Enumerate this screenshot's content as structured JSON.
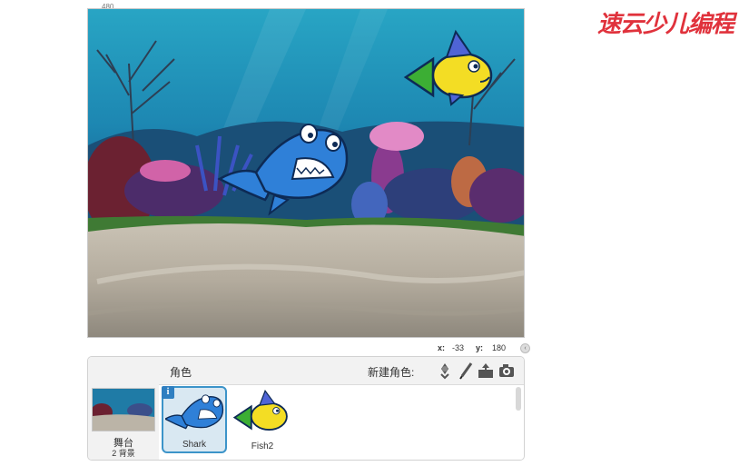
{
  "stage": {
    "corner_label": "480"
  },
  "coords": {
    "x_label": "x:",
    "x_value": "-33",
    "y_label": "y:",
    "y_value": "180"
  },
  "sprite_pane": {
    "stage_thumb": {
      "label": "舞台",
      "sub": "2 背景"
    },
    "title": "角色",
    "new_sprite_label": "新建角色:",
    "tools": [
      "choose-sprite-from-library-icon",
      "paint-new-sprite-icon",
      "upload-sprite-icon",
      "camera-icon"
    ],
    "sprites": [
      {
        "name": "Shark",
        "selected": true
      },
      {
        "name": "Fish2",
        "selected": false
      }
    ]
  },
  "logo": {
    "text": "速云少儿编程"
  },
  "colors": {
    "selection": "#3c94c9",
    "info": "#2f7fc1",
    "shark": "#2f80d8",
    "fish_yellow": "#f3dd24",
    "fish_green": "#3cae34"
  }
}
